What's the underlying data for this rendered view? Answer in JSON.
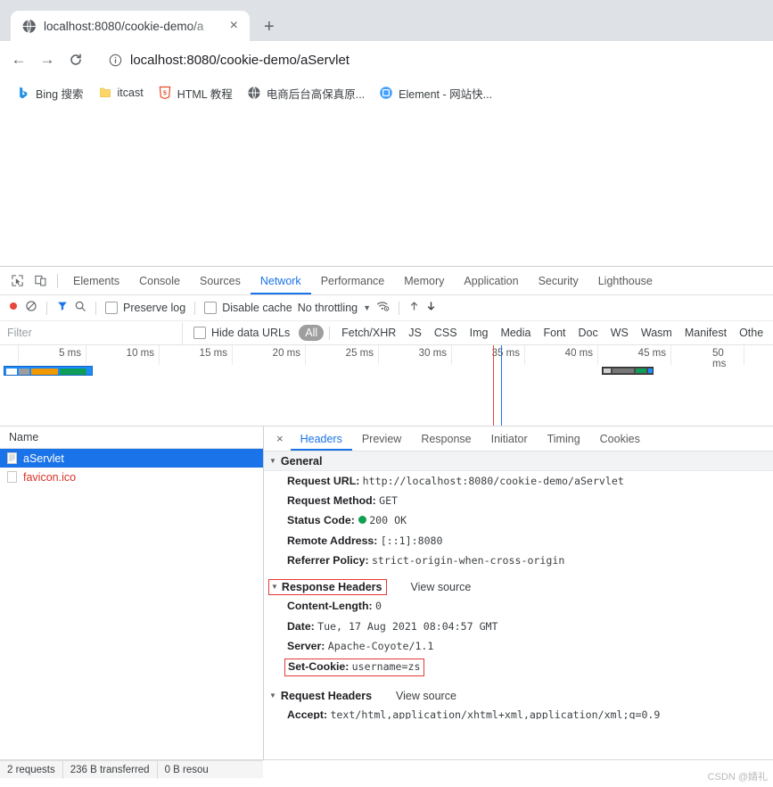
{
  "browser": {
    "tab": {
      "title": "localhost:8080/cookie-demo/a",
      "favicon": "globe-icon",
      "close_label": "×"
    },
    "new_tab_label": "+",
    "nav": {
      "back": "←",
      "forward": "→",
      "reload": "C"
    },
    "omnibox": {
      "url": "localhost:8080/cookie-demo/aServlet",
      "info_icon": "info-circle-icon"
    },
    "bookmarks": [
      {
        "label": "Bing 搜索",
        "icon": "bing-icon"
      },
      {
        "label": "itcast",
        "icon": "folder-icon"
      },
      {
        "label": "HTML 教程",
        "icon": "html5-icon"
      },
      {
        "label": "电商后台高保真原...",
        "icon": "globe-icon"
      },
      {
        "label": "Element - 网站快...",
        "icon": "element-icon"
      }
    ]
  },
  "devtools": {
    "left_icons": [
      {
        "name": "inspect-element-icon"
      },
      {
        "name": "device-toolbar-icon"
      }
    ],
    "tabs": [
      {
        "label": "Elements",
        "active": false
      },
      {
        "label": "Console",
        "active": false
      },
      {
        "label": "Sources",
        "active": false
      },
      {
        "label": "Network",
        "active": true
      },
      {
        "label": "Performance",
        "active": false
      },
      {
        "label": "Memory",
        "active": false
      },
      {
        "label": "Application",
        "active": false
      },
      {
        "label": "Security",
        "active": false
      },
      {
        "label": "Lighthouse",
        "active": false
      }
    ],
    "network_toolbar": {
      "record_label": "record-button",
      "clear_label": "clear-button",
      "filter_label": "filter-button",
      "search_label": "search-button",
      "preserve_log": "Preserve log",
      "disable_cache": "Disable cache",
      "throttling": "No throttling",
      "throttle_caret": "▼",
      "wifi_label": "network-conditions-icon",
      "import_label": "import-har-icon",
      "export_label": "export-har-icon"
    },
    "filter_row": {
      "placeholder": "Filter",
      "hide_data_urls": "Hide data URLs",
      "types": [
        {
          "label": "All",
          "active": true
        },
        {
          "label": "Fetch/XHR",
          "active": false
        },
        {
          "label": "JS",
          "active": false
        },
        {
          "label": "CSS",
          "active": false
        },
        {
          "label": "Img",
          "active": false
        },
        {
          "label": "Media",
          "active": false
        },
        {
          "label": "Font",
          "active": false
        },
        {
          "label": "Doc",
          "active": false
        },
        {
          "label": "WS",
          "active": false
        },
        {
          "label": "Wasm",
          "active": false
        },
        {
          "label": "Manifest",
          "active": false
        },
        {
          "label": "Othe",
          "active": false
        }
      ]
    },
    "overview": {
      "ticks": [
        "5 ms",
        "10 ms",
        "15 ms",
        "20 ms",
        "25 ms",
        "30 ms",
        "35 ms",
        "40 ms",
        "45 ms",
        "50 ms"
      ]
    },
    "requests": {
      "column_header": "Name",
      "items": [
        {
          "name": "aServlet",
          "selected": true,
          "error": false
        },
        {
          "name": "favicon.ico",
          "selected": false,
          "error": true
        }
      ]
    },
    "detail_tabs": [
      {
        "label": "Headers",
        "active": true
      },
      {
        "label": "Preview",
        "active": false
      },
      {
        "label": "Response",
        "active": false
      },
      {
        "label": "Initiator",
        "active": false
      },
      {
        "label": "Timing",
        "active": false
      },
      {
        "label": "Cookies",
        "active": false
      }
    ],
    "headers": {
      "general": {
        "title": "General",
        "rows": [
          {
            "key": "Request URL:",
            "value": "http://localhost:8080/cookie-demo/aServlet"
          },
          {
            "key": "Request Method:",
            "value": "GET"
          },
          {
            "key": "Status Code:",
            "value": "200 OK",
            "status_dot": true
          },
          {
            "key": "Remote Address:",
            "value": "[::1]:8080"
          },
          {
            "key": "Referrer Policy:",
            "value": "strict-origin-when-cross-origin"
          }
        ]
      },
      "response": {
        "title": "Response Headers",
        "view_source": "View source",
        "rows": [
          {
            "key": "Content-Length:",
            "value": "0"
          },
          {
            "key": "Date:",
            "value": "Tue, 17 Aug 2021 08:04:57 GMT"
          },
          {
            "key": "Server:",
            "value": "Apache-Coyote/1.1"
          },
          {
            "key": "Set-Cookie:",
            "value": "username=zs",
            "highlight": true
          }
        ]
      },
      "request": {
        "title": "Request Headers",
        "view_source": "View source",
        "rows": [
          {
            "key": "Accept:",
            "value": "text/html,application/xhtml+xml,application/xml;q=0.9"
          }
        ]
      }
    },
    "status_bar": {
      "requests": "2 requests",
      "transferred": "236 B transferred",
      "resources": "0 B resou"
    }
  },
  "watermark": "CSDN @婧礼",
  "colors": {
    "accent": "#1a73e8",
    "annotation": "#e53935",
    "error_text": "#d93025",
    "status_ok": "#10a050"
  }
}
